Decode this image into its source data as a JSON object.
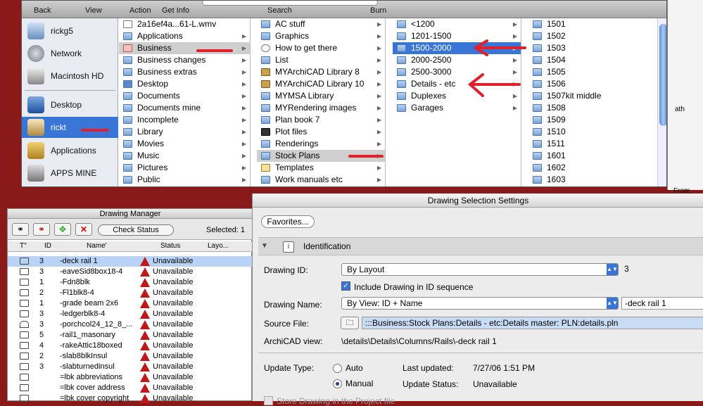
{
  "finder": {
    "toolbar": {
      "back": "Back",
      "view": "View",
      "action": "Action",
      "get_info": "Get Info",
      "search": "Search",
      "burn": "Burn"
    },
    "sidebar": [
      {
        "label": "rickg5",
        "icon": "computer-icon"
      },
      {
        "label": "Network",
        "icon": "network-globe-icon"
      },
      {
        "label": "Macintosh HD",
        "icon": "hard-disk-icon"
      },
      {
        "label": "Desktop",
        "icon": "desktop-icon"
      },
      {
        "label": "rickt",
        "icon": "home-icon"
      },
      {
        "label": "Applications",
        "icon": "applications-icon"
      },
      {
        "label": "APPS MINE",
        "icon": "apps-icon"
      }
    ],
    "col1": [
      "2a16ef4a...61-L.wmv",
      "Applications",
      "Business",
      "Business changes",
      "Business extras",
      "Desktop",
      "Documents",
      "Documents mine",
      "Incomplete",
      "Library",
      "Movies",
      "Music",
      "Pictures",
      "Public"
    ],
    "col2": [
      "AC stuff",
      "Graphics",
      "How to get there",
      "List",
      "MYArchiCAD Library 8",
      "MYArchiCAD Library 10",
      "MYMSA Library",
      "MYRendering images",
      "Plan book 7",
      "Plot files",
      "Renderings",
      "Stock Plans",
      "Templates",
      "Work manuals etc"
    ],
    "col3": [
      "<1200",
      "1201-1500",
      "1500-2000",
      "2000-2500",
      "2500-3000",
      "Details - etc",
      "Duplexes",
      "Garages"
    ],
    "col4": [
      "1501",
      "1502",
      "1503",
      "1504",
      "1505",
      "1506",
      "1507kit middle",
      "1508",
      "1509",
      "1510",
      "1511",
      "1601",
      "1602",
      "1603"
    ]
  },
  "bg_window": {
    "label1": "ath",
    "label2": "From"
  },
  "drawing_manager": {
    "title": "Drawing Manager",
    "check_status": "Check Status",
    "selected": "Selected: 1",
    "columns": {
      "t": "T\"",
      "id": "ID",
      "name": "Name'",
      "status": "Status",
      "layout": "Layo..."
    },
    "rows": [
      {
        "id": "3",
        "name": "-deck rail 1",
        "status": "Unavailable"
      },
      {
        "id": "3",
        "name": "-eaveSid8box18-4",
        "status": "Unavailable"
      },
      {
        "id": "1",
        "name": "-Fdn8blk",
        "status": "Unavailable"
      },
      {
        "id": "2",
        "name": "-Fl1blk8-4",
        "status": "Unavailable"
      },
      {
        "id": "1",
        "name": "-grade beam 2x6",
        "status": "Unavailable"
      },
      {
        "id": "3",
        "name": "-ledgerblk8-4",
        "status": "Unavailable"
      },
      {
        "id": "3",
        "name": "-porchcol24_12_8_...",
        "status": "Unavailable"
      },
      {
        "id": "5",
        "name": "-rail1_masonary",
        "status": "Unavailable"
      },
      {
        "id": "4",
        "name": "-rakeAttic18boxed",
        "status": "Unavailable"
      },
      {
        "id": "2",
        "name": "-slab8blkInsul",
        "status": "Unavailable"
      },
      {
        "id": "3",
        "name": "-slabturnedinsul",
        "status": "Unavailable"
      },
      {
        "id": "",
        "name": "=lbk abbreviations",
        "status": "Unavailable"
      },
      {
        "id": "",
        "name": "=lbk cover address",
        "status": "Unavailable"
      },
      {
        "id": "",
        "name": "=lbk cover copyright",
        "status": "Unavailable"
      }
    ]
  },
  "settings": {
    "title": "Drawing Selection Settings",
    "favorites": "Favorites...",
    "section": "Identification",
    "drawing_id_label": "Drawing ID:",
    "drawing_id_value": "By Layout",
    "drawing_id_num": "3",
    "include_label": "Include Drawing in ID sequence",
    "drawing_name_label": "Drawing Name:",
    "drawing_name_value": "By View: ID + Name",
    "drawing_name_text": "-deck rail 1",
    "source_label": "Source File:",
    "source_value": ":::Business:Stock Plans:Details - etc:Details master: PLN:details.pln",
    "view_label": "ArchiCAD view:",
    "view_value": "\\details\\Details\\Columns/Rails\\-deck rail 1",
    "update_type_label": "Update Type:",
    "auto_label": "Auto",
    "manual_label": "Manual",
    "last_updated_label": "Last updated:",
    "last_updated_value": "7/27/06 1:51 PM",
    "update_status_label": "Update Status:",
    "update_status_value": "Unavailable",
    "store_label": "Store Drawing in the Project file"
  }
}
